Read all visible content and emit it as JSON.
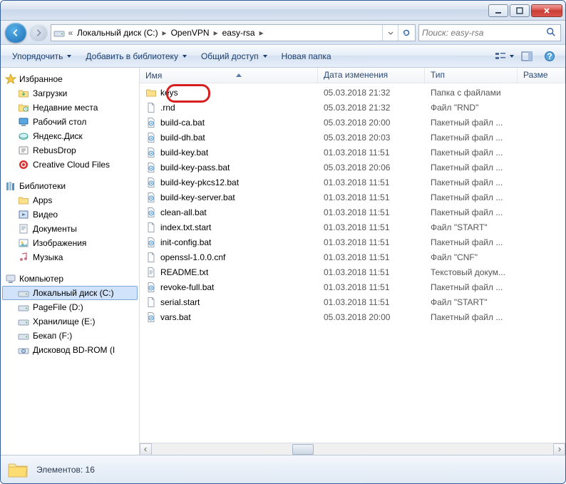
{
  "breadcrumb": [
    {
      "label": "Локальный диск (C:)"
    },
    {
      "label": "OpenVPN"
    },
    {
      "label": "easy-rsa"
    }
  ],
  "search": {
    "placeholder": "Поиск: easy-rsa"
  },
  "toolbar": {
    "organize": "Упорядочить",
    "add_library": "Добавить в библиотеку",
    "share": "Общий доступ",
    "new_folder": "Новая папка"
  },
  "sidebar": {
    "favorites": {
      "label": "Избранное",
      "items": [
        {
          "label": "Загрузки",
          "icon": "downloads"
        },
        {
          "label": "Недавние места",
          "icon": "recent"
        },
        {
          "label": "Рабочий стол",
          "icon": "desktop"
        },
        {
          "label": "Яндекс.Диск",
          "icon": "yadisk"
        },
        {
          "label": "RebusDrop",
          "icon": "rebus"
        },
        {
          "label": "Creative Cloud Files",
          "icon": "cc"
        }
      ]
    },
    "libraries": {
      "label": "Библиотеки",
      "items": [
        {
          "label": "Apps",
          "icon": "folder"
        },
        {
          "label": "Видео",
          "icon": "video"
        },
        {
          "label": "Документы",
          "icon": "docs"
        },
        {
          "label": "Изображения",
          "icon": "images"
        },
        {
          "label": "Музыка",
          "icon": "music"
        }
      ]
    },
    "computer": {
      "label": "Компьютер",
      "items": [
        {
          "label": "Локальный диск (C:)",
          "icon": "hdd",
          "selected": true
        },
        {
          "label": "PageFile (D:)",
          "icon": "hdd"
        },
        {
          "label": "Хранилище (E:)",
          "icon": "hdd"
        },
        {
          "label": "Бекап (F:)",
          "icon": "hdd"
        },
        {
          "label": "Дисковод BD-ROM (I",
          "icon": "bd"
        }
      ]
    }
  },
  "columns": {
    "name": "Имя",
    "date": "Дата изменения",
    "type": "Тип",
    "size": "Разме"
  },
  "files": [
    {
      "name": "keys",
      "date": "05.03.2018 21:32",
      "type": "Папка с файлами",
      "icon": "folder"
    },
    {
      "name": ".rnd",
      "date": "05.03.2018 21:32",
      "type": "Файл \"RND\"",
      "icon": "file"
    },
    {
      "name": "build-ca.bat",
      "date": "05.03.2018 20:00",
      "type": "Пакетный файл ...",
      "icon": "bat"
    },
    {
      "name": "build-dh.bat",
      "date": "05.03.2018 20:03",
      "type": "Пакетный файл ...",
      "icon": "bat"
    },
    {
      "name": "build-key.bat",
      "date": "01.03.2018 11:51",
      "type": "Пакетный файл ...",
      "icon": "bat"
    },
    {
      "name": "build-key-pass.bat",
      "date": "05.03.2018 20:06",
      "type": "Пакетный файл ...",
      "icon": "bat"
    },
    {
      "name": "build-key-pkcs12.bat",
      "date": "01.03.2018 11:51",
      "type": "Пакетный файл ...",
      "icon": "bat"
    },
    {
      "name": "build-key-server.bat",
      "date": "01.03.2018 11:51",
      "type": "Пакетный файл ...",
      "icon": "bat"
    },
    {
      "name": "clean-all.bat",
      "date": "01.03.2018 11:51",
      "type": "Пакетный файл ...",
      "icon": "bat"
    },
    {
      "name": "index.txt.start",
      "date": "01.03.2018 11:51",
      "type": "Файл \"START\"",
      "icon": "file"
    },
    {
      "name": "init-config.bat",
      "date": "01.03.2018 11:51",
      "type": "Пакетный файл ...",
      "icon": "bat"
    },
    {
      "name": "openssl-1.0.0.cnf",
      "date": "01.03.2018 11:51",
      "type": "Файл \"CNF\"",
      "icon": "file"
    },
    {
      "name": "README.txt",
      "date": "01.03.2018 11:51",
      "type": "Текстовый докум...",
      "icon": "txt"
    },
    {
      "name": "revoke-full.bat",
      "date": "01.03.2018 11:51",
      "type": "Пакетный файл ...",
      "icon": "bat"
    },
    {
      "name": "serial.start",
      "date": "01.03.2018 11:51",
      "type": "Файл \"START\"",
      "icon": "file"
    },
    {
      "name": "vars.bat",
      "date": "05.03.2018 20:00",
      "type": "Пакетный файл ...",
      "icon": "bat"
    }
  ],
  "status": {
    "count_label": "Элементов: 16"
  }
}
